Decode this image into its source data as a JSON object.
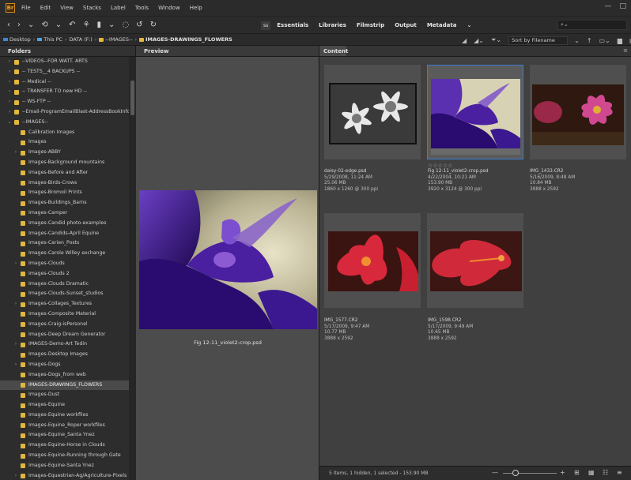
{
  "menu": {
    "logo": "Br",
    "items": [
      "File",
      "Edit",
      "View",
      "Stacks",
      "Label",
      "Tools",
      "Window",
      "Help"
    ],
    "window_controls": [
      "—",
      "□"
    ]
  },
  "toolbar": {
    "icons": [
      "‹",
      "›",
      "⌄",
      "⟲",
      "⌄",
      "↶",
      "⚘",
      "▮",
      "⌄",
      "◌",
      "↺",
      "↻"
    ],
    "badge": "ss",
    "workspaces": [
      "Essentials",
      "Libraries",
      "Filmstrip",
      "Output",
      "Metadata"
    ],
    "workspace_more": "⌄",
    "search_placeholder": "⌕⌄"
  },
  "path": {
    "crumbs": [
      {
        "label": "Desktop",
        "glyph": "drive"
      },
      {
        "label": "This PC",
        "glyph": "pc"
      },
      {
        "label": "DATA (F:)",
        "glyph": "none"
      },
      {
        "label": "--IMAGES--",
        "glyph": "folder"
      },
      {
        "label": "IMAGES-DRAWINGS_FLOWERS",
        "glyph": "folder"
      }
    ],
    "separator": "›",
    "right_icons": [
      "◢",
      "◢⌄",
      "⏷⌄"
    ],
    "sort_label": "Sort by Filename",
    "sort_icons": [
      "⌄",
      "↑",
      "▭⌄",
      "▆",
      "▤"
    ]
  },
  "panels": {
    "folders_tab": "Folders",
    "preview_tab": "Preview",
    "content_tab": "Content",
    "menu_icon": "≡"
  },
  "folders": [
    {
      "label": "--VIDEOS--FOR WATT. ARTS",
      "level": 1,
      "arrow": "›"
    },
    {
      "label": "-- TESTS__4 BACKUPS --",
      "level": 1,
      "arrow": "›"
    },
    {
      "label": "-- Medical --",
      "level": 1,
      "arrow": "›"
    },
    {
      "label": "-- TRANSFER TO new HD --",
      "level": 1,
      "arrow": "›"
    },
    {
      "label": "-- WS-FTP --",
      "level": 1,
      "arrow": "›"
    },
    {
      "label": "--Email-ProgramEmailBlast-AddressBookInfo",
      "level": 1,
      "arrow": "›"
    },
    {
      "label": "--IMAGES--",
      "level": 1,
      "arrow": "⌄"
    },
    {
      "label": "Calibration Images",
      "level": 2,
      "arrow": ""
    },
    {
      "label": "Images",
      "level": 2,
      "arrow": ""
    },
    {
      "label": "Images-ABBY",
      "level": 2,
      "arrow": "›"
    },
    {
      "label": "Images-Background mountains",
      "level": 2,
      "arrow": ""
    },
    {
      "label": "Images-Before and After",
      "level": 2,
      "arrow": ""
    },
    {
      "label": "Images-Birds-Crows",
      "level": 2,
      "arrow": ""
    },
    {
      "label": "Images-Bromoil Prints",
      "level": 2,
      "arrow": ""
    },
    {
      "label": "Images-Buildings_Barns",
      "level": 2,
      "arrow": ""
    },
    {
      "label": "Images-Camper",
      "level": 2,
      "arrow": ""
    },
    {
      "label": "Images-Candid photo-examples",
      "level": 2,
      "arrow": ""
    },
    {
      "label": "Images-Candids-April Equine",
      "level": 2,
      "arrow": ""
    },
    {
      "label": "Images-Carien_Posts",
      "level": 2,
      "arrow": ""
    },
    {
      "label": "Images-Carole Willey exchange",
      "level": 2,
      "arrow": ""
    },
    {
      "label": "Images-Clouds",
      "level": 2,
      "arrow": "›"
    },
    {
      "label": "Images-Clouds 2",
      "level": 2,
      "arrow": ""
    },
    {
      "label": "Images-Clouds Dramatic",
      "level": 2,
      "arrow": ""
    },
    {
      "label": "Images-Clouds-Sunset_studios",
      "level": 2,
      "arrow": ""
    },
    {
      "label": "Images-Collages_Textures",
      "level": 2,
      "arrow": "›"
    },
    {
      "label": "Images-Composite Material",
      "level": 2,
      "arrow": ""
    },
    {
      "label": "Images-Craig-isPersonel",
      "level": 2,
      "arrow": ""
    },
    {
      "label": "Images-Deep Dream Generator",
      "level": 2,
      "arrow": ""
    },
    {
      "label": "IMAGES-Demo-Art Tedin",
      "level": 2,
      "arrow": "›"
    },
    {
      "label": "Images-Desktop Images",
      "level": 2,
      "arrow": ""
    },
    {
      "label": "Images-Dogs",
      "level": 2,
      "arrow": "›"
    },
    {
      "label": "Images-Dogs_from web",
      "level": 2,
      "arrow": ""
    },
    {
      "label": "IMAGES-DRAWINGS_FLOWERS",
      "level": 2,
      "arrow": "",
      "selected": true
    },
    {
      "label": "Images-Dust",
      "level": 2,
      "arrow": ""
    },
    {
      "label": "Images-Equine",
      "level": 2,
      "arrow": ""
    },
    {
      "label": "Images-Equine workfiles",
      "level": 2,
      "arrow": ""
    },
    {
      "label": "Images-Equine_Roper workfiles",
      "level": 2,
      "arrow": ""
    },
    {
      "label": "Images-Equine_Santa Ynez",
      "level": 2,
      "arrow": ""
    },
    {
      "label": "Images-Equine-Horse in Clouds",
      "level": 2,
      "arrow": ""
    },
    {
      "label": "Images-Equine-Running through Gate",
      "level": 2,
      "arrow": ""
    },
    {
      "label": "Images-Equine-Santa Ynez",
      "level": 2,
      "arrow": ""
    },
    {
      "label": "Images-Equestrian-Ag/Agriculture-Pixels",
      "level": 2,
      "arrow": "›"
    }
  ],
  "preview": {
    "caption": "Fig 12-11_violet2-crop.psd"
  },
  "thumbnails": [
    {
      "name": "daisy-02-edge.psd",
      "date": "5/29/2008, 11:24 AM",
      "size": "25.06 MB",
      "dims": "1860 x 1260 @ 300 ppi",
      "stars": "",
      "kind": "daisy",
      "selected": false
    },
    {
      "name": "Fig 12-11_violet2-crop.psd",
      "date": "4/22/2004, 10:21 AM",
      "size": "153.90 MB",
      "dims": "3920 x 3124 @ 300 ppi",
      "stars": "☆☆☆☆☆",
      "kind": "iris",
      "selected": true
    },
    {
      "name": "IMG_1433.CR2",
      "date": "5/16/2009, 8:48 AM",
      "size": "10.84 MB",
      "dims": "3888 x 2592",
      "stars": "",
      "kind": "cosmos",
      "selected": false
    },
    {
      "name": "IMG_1577.CR2",
      "date": "5/17/2009, 9:47 AM",
      "size": "10.77 MB",
      "dims": "3888 x 2592",
      "stars": "",
      "kind": "hibiscus",
      "selected": false
    },
    {
      "name": "IMG_1598.CR2",
      "date": "5/17/2009, 9:49 AM",
      "size": "10.65 MB",
      "dims": "3888 x 2592",
      "stars": "",
      "kind": "hibiscus2",
      "selected": false
    }
  ],
  "status": {
    "text": "5 items, 1 hidden, 1 selected - 153.90 MB",
    "zoom_minus": "—",
    "zoom_plus": "+",
    "view_icons": [
      "⊞",
      "▦",
      "☷",
      "≡"
    ]
  }
}
